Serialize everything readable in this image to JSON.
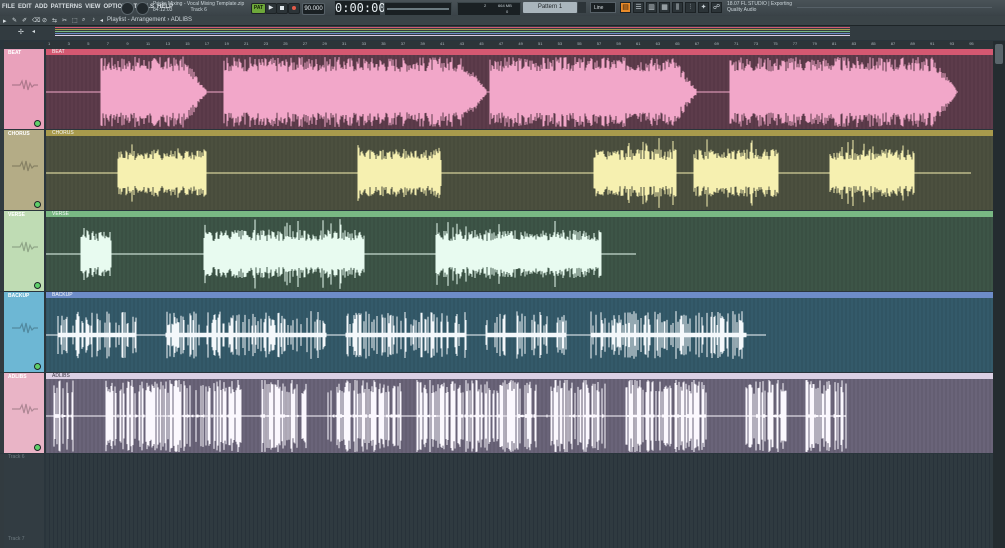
{
  "menu": [
    "FILE",
    "EDIT",
    "ADD",
    "PATTERNS",
    "VIEW",
    "OPTIONS",
    "TOOLS",
    "HELP"
  ],
  "project": {
    "file": "Pricks Mixing - Vocal Mixing Template.zip",
    "time": "84:12:03",
    "track": "Track 6"
  },
  "transport": {
    "pattern_label": "PAT",
    "play": "▶",
    "tempo": "90.000",
    "clock": "0:00:00",
    "clock_sub": "M:S:CS"
  },
  "cpu": {
    "voices": "2",
    "mem": "664 MB",
    "poly": "0"
  },
  "pattern_selector": "Pattern 1",
  "snap": "Line",
  "news": {
    "date": "18.07",
    "line1": "FL STUDIO | Exporting",
    "line2": "Quality Audio"
  },
  "playlist_title": "Playlist - Arrangement › ADLIBS",
  "ruler_ticks": [
    "1",
    "3",
    "5",
    "7",
    "9",
    "11",
    "13",
    "15",
    "17",
    "19",
    "21",
    "23",
    "25",
    "27",
    "29",
    "31",
    "33",
    "35",
    "37",
    "39",
    "41",
    "43",
    "45",
    "47",
    "49",
    "51",
    "53",
    "55",
    "57",
    "59",
    "61",
    "63",
    "65",
    "67",
    "69",
    "71",
    "73",
    "75",
    "77",
    "79",
    "81",
    "83",
    "85",
    "87",
    "89",
    "91",
    "93",
    "95"
  ],
  "tracks": [
    {
      "name": "BEAT",
      "clip": "BEAT",
      "header_color": "#e9a1bb",
      "clip_head": "#d45871",
      "lane": "#5d3c4b",
      "wave": "#f2a7c9"
    },
    {
      "name": "CHORUS",
      "clip": "CHORUS",
      "header_color": "#b4ac86",
      "clip_head": "#a89a4c",
      "lane": "#4c503f",
      "wave": "#f6f0b0"
    },
    {
      "name": "VERSE",
      "clip": "VERSE",
      "header_color": "#bfdcb4",
      "clip_head": "#79b883",
      "lane": "#3d5547",
      "wave": "#e8fbf0"
    },
    {
      "name": "BACKUP",
      "clip": "BACKUP",
      "header_color": "#6db7d4",
      "clip_head": "#6d8cc8",
      "lane": "#345a6a",
      "wave": "#f4f8fb"
    },
    {
      "name": "ADLIBS",
      "clip": "ADLIBS",
      "header_color": "#e9b4c6",
      "clip_head": "#dcd0e4",
      "lane": "#6a6479",
      "wave": "#fbf8fe"
    }
  ],
  "empty_tracks": [
    "Track 6",
    "Track 7"
  ]
}
